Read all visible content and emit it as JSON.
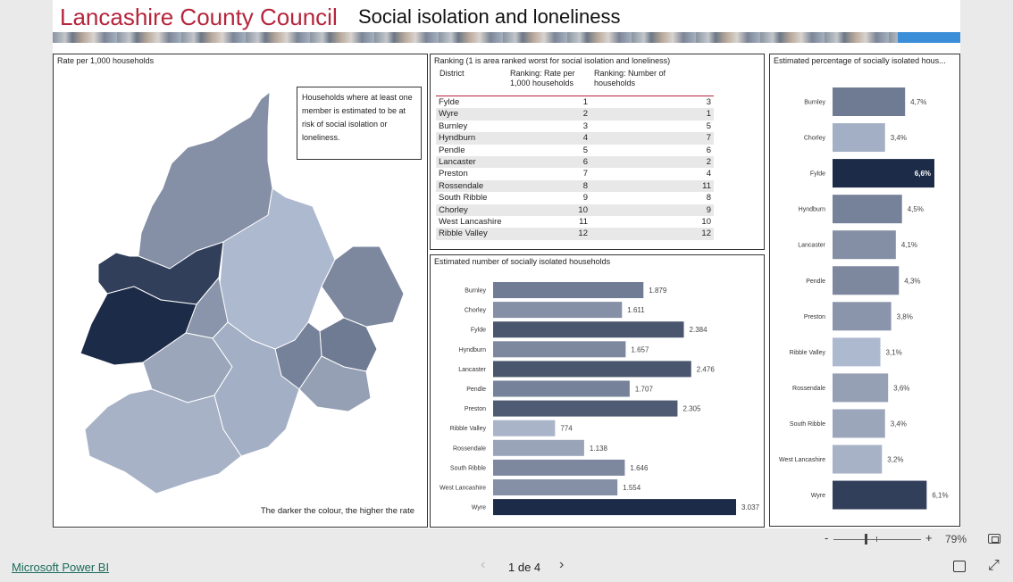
{
  "header": {
    "title": "Lancashire County Council",
    "subtitle": "Social isolation and loneliness",
    "title_color": "#b5253c"
  },
  "map": {
    "title": "Rate per 1,000 households",
    "note": "Households where at least one member is estimated to be at risk of social isolation or loneliness.",
    "footer": "The darker the colour, the higher the rate"
  },
  "ranking": {
    "title": "Ranking (1 is area ranked worst for social isolation and loneliness)",
    "headers": [
      "District",
      "Ranking: Rate per 1,000 households",
      "Ranking: Number of households"
    ],
    "rows": [
      [
        "Fylde",
        "1",
        "3"
      ],
      [
        "Wyre",
        "2",
        "1"
      ],
      [
        "Burnley",
        "3",
        "5"
      ],
      [
        "Hyndburn",
        "4",
        "7"
      ],
      [
        "Pendle",
        "5",
        "6"
      ],
      [
        "Lancaster",
        "6",
        "2"
      ],
      [
        "Preston",
        "7",
        "4"
      ],
      [
        "Rossendale",
        "8",
        "11"
      ],
      [
        "South Ribble",
        "9",
        "8"
      ],
      [
        "Chorley",
        "10",
        "9"
      ],
      [
        "West Lancashire",
        "11",
        "10"
      ],
      [
        "Ribble Valley",
        "12",
        "12"
      ]
    ]
  },
  "chart_data": [
    {
      "type": "bar",
      "orientation": "horizontal",
      "title": "Estimated number of socially isolated households",
      "categories": [
        "Burnley",
        "Chorley",
        "Fylde",
        "Hyndburn",
        "Lancaster",
        "Pendle",
        "Preston",
        "Ribble Valley",
        "Rossendale",
        "South Ribble",
        "West Lancashire",
        "Wyre"
      ],
      "values": [
        1879,
        1611,
        2384,
        1657,
        2476,
        1707,
        2305,
        774,
        1138,
        1646,
        1554,
        3037
      ],
      "labels": [
        "1.879",
        "1.611",
        "2.384",
        "1.657",
        "2.476",
        "1.707",
        "2.305",
        "774",
        "1.138",
        "1.646",
        "1.554",
        "3.037"
      ],
      "colors": [
        "#707c94",
        "#8590a6",
        "#4a566e",
        "#7d889f",
        "#4a566e",
        "#76829a",
        "#4f5b73",
        "#a9b4c9",
        "#9aa4b8",
        "#7d889f",
        "#8590a6",
        "#1c2b47"
      ],
      "xlim": [
        0,
        3037
      ]
    },
    {
      "type": "bar",
      "orientation": "horizontal",
      "title": "Estimated percentage of socially isolated hous...",
      "categories": [
        "Burnley",
        "Chorley",
        "Fylde",
        "Hyndburn",
        "Lancaster",
        "Pendle",
        "Preston",
        "Ribble Valley",
        "Rossendale",
        "South Ribble",
        "West Lancashire",
        "Wyre"
      ],
      "values": [
        4.7,
        3.4,
        6.6,
        4.5,
        4.1,
        4.3,
        3.8,
        3.1,
        3.6,
        3.4,
        3.2,
        6.1
      ],
      "labels": [
        "4,7%",
        "3,4%",
        "6,6%",
        "4,5%",
        "4,1%",
        "4,3%",
        "3,8%",
        "3,1%",
        "3,6%",
        "3,4%",
        "3,2%",
        "6,1%"
      ],
      "colors": [
        "#6f7b93",
        "#a3afc4",
        "#1c2b47",
        "#76829a",
        "#848fa5",
        "#7d889f",
        "#8a95ab",
        "#adb9cf",
        "#95a0b5",
        "#9ba6bb",
        "#a7b2c7",
        "#323f5b"
      ],
      "xlim": [
        0,
        6.6
      ]
    }
  ],
  "footer": {
    "zoom_minus": "-",
    "zoom_plus": "+",
    "zoom_value": "79%",
    "brand": "Microsoft Power BI",
    "prev_arrow": "‹",
    "page_indicator": "1 de 4",
    "next_arrow": "›",
    "expand_glyph": "⤢"
  }
}
